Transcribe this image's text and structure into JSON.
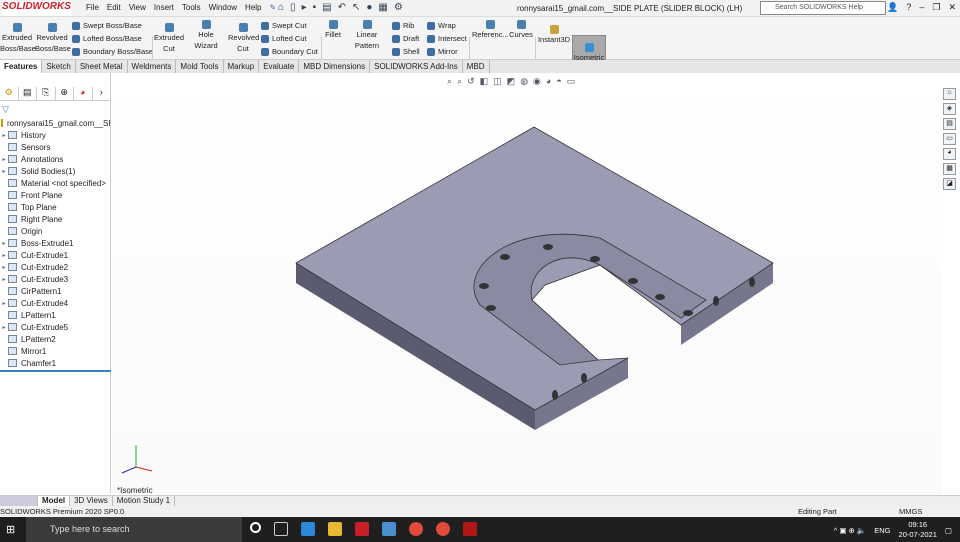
{
  "app": {
    "logo": "SOLIDWORKS",
    "title": "ronnysarai15_gmail.com__SIDE PLATE (SLIDER BLOCK) (LH)",
    "search_placeholder": "Search SOLIDWORKS Help"
  },
  "menu": [
    "File",
    "Edit",
    "View",
    "Insert",
    "Tools",
    "Window",
    "Help"
  ],
  "ribbon": {
    "extruded_boss": "Extruded Boss/Base",
    "revolved_boss": "Revolved Boss/Base",
    "swept_boss": "Swept Boss/Base",
    "lofted_boss": "Lofted Boss/Base",
    "boundary_boss": "Boundary Boss/Base",
    "extruded_cut": "Extruded Cut",
    "hole_wizard": "Hole Wizard",
    "revolved_cut": "Revolved Cut",
    "swept_cut": "Swept Cut",
    "lofted_cut": "Lofted Cut",
    "boundary_cut": "Boundary Cut",
    "fillet": "Fillet",
    "linear_pattern": "Linear Pattern",
    "rib": "Rib",
    "draft": "Draft",
    "shell": "Shell",
    "wrap": "Wrap",
    "intersect": "Intersect",
    "mirror": "Mirror",
    "reference": "Referenc...",
    "curves": "Curves",
    "instant3d": "Instant3D",
    "isometric": "Isometric"
  },
  "tabs": [
    "Features",
    "Sketch",
    "Sheet Metal",
    "Weldments",
    "Mold Tools",
    "Markup",
    "Evaluate",
    "MBD Dimensions",
    "SOLIDWORKS Add-Ins",
    "MBD"
  ],
  "tree": {
    "root": "ronnysarai15_gmail.com__SIDE",
    "items": [
      {
        "label": "History",
        "exp": true
      },
      {
        "label": "Sensors",
        "exp": false
      },
      {
        "label": "Annotations",
        "exp": true
      },
      {
        "label": "Solid Bodies(1)",
        "exp": true
      },
      {
        "label": "Material <not specified>",
        "exp": false
      },
      {
        "label": "Front Plane",
        "exp": false
      },
      {
        "label": "Top Plane",
        "exp": false
      },
      {
        "label": "Right Plane",
        "exp": false
      },
      {
        "label": "Origin",
        "exp": false
      },
      {
        "label": "Boss-Extrude1",
        "exp": true
      },
      {
        "label": "Cut-Extrude1",
        "exp": true
      },
      {
        "label": "Cut-Extrude2",
        "exp": true
      },
      {
        "label": "Cut-Extrude3",
        "exp": true
      },
      {
        "label": "CirPattern1",
        "exp": false
      },
      {
        "label": "Cut-Extrude4",
        "exp": true
      },
      {
        "label": "LPattern1",
        "exp": false
      },
      {
        "label": "Cut-Extrude5",
        "exp": true
      },
      {
        "label": "LPattern2",
        "exp": false
      },
      {
        "label": "Mirror1",
        "exp": false
      },
      {
        "label": "Chamfer1",
        "exp": false
      }
    ]
  },
  "viewport": {
    "view_label": "*Isometric",
    "part_color": "#9b9bb4"
  },
  "bottom_tabs": [
    "Model",
    "3D Views",
    "Motion Study 1"
  ],
  "status": {
    "product": "SOLIDWORKS Premium 2020 SP0.0",
    "mode": "Editing Part",
    "units": "MMGS"
  },
  "taskbar": {
    "search": "Type here to search",
    "lang": "ENG",
    "time": "09:16",
    "date": "20-07-2021"
  }
}
